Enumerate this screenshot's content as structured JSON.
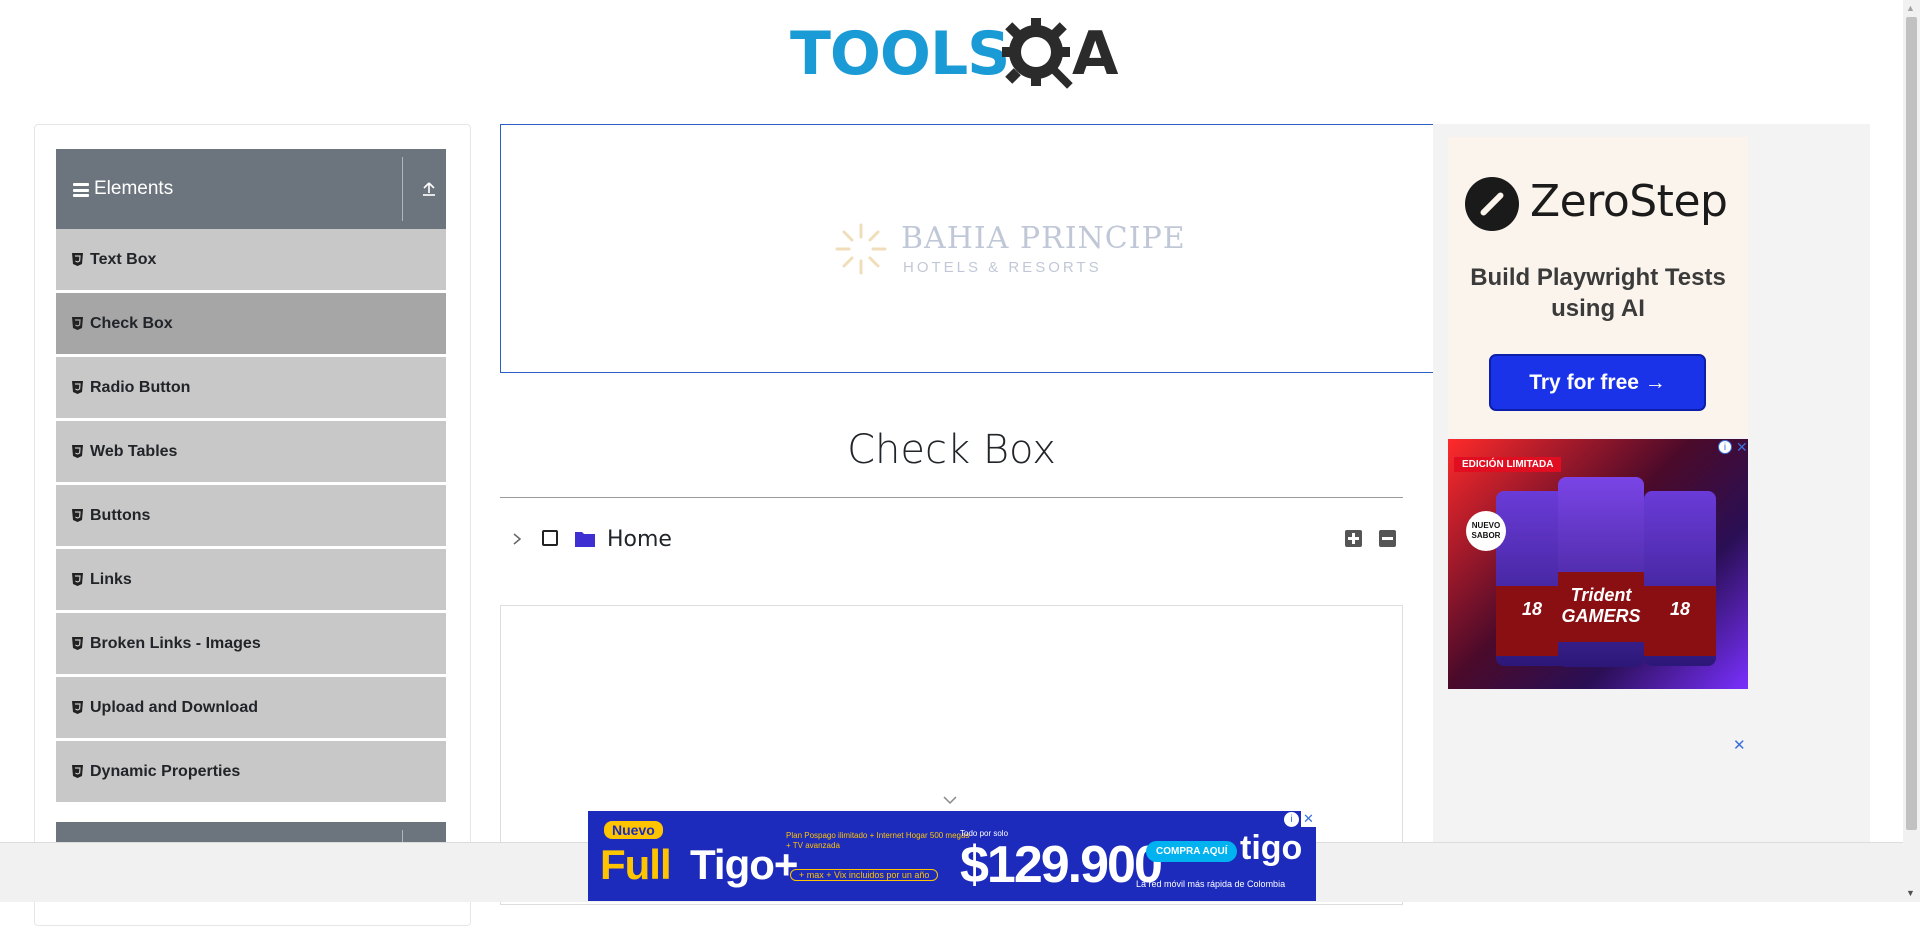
{
  "header": {
    "logo_text_left": "TOOLS",
    "logo_text_right": "A",
    "logo_alt": "TOOLSQA"
  },
  "sidebar": {
    "group_title": "Elements",
    "items": [
      {
        "label": "Text Box",
        "active": false
      },
      {
        "label": "Check Box",
        "active": true
      },
      {
        "label": "Radio Button",
        "active": false
      },
      {
        "label": "Web Tables",
        "active": false
      },
      {
        "label": "Buttons",
        "active": false
      },
      {
        "label": "Links",
        "active": false
      },
      {
        "label": "Broken Links - Images",
        "active": false
      },
      {
        "label": "Upload and Download",
        "active": false
      },
      {
        "label": "Dynamic Properties",
        "active": false
      }
    ]
  },
  "top_ad": {
    "brand": "BAHIA PRINCIPE",
    "tagline": "HOTELS & RESORTS"
  },
  "main": {
    "title": "Check Box",
    "tree": {
      "root_label": "Home",
      "checked": false,
      "expanded": false
    }
  },
  "right_ads": {
    "zerostep": {
      "name": "ZeroStep",
      "tagline": "Build Playwright Tests using AI",
      "cta": "Try for free →"
    },
    "trident": {
      "ribbon": "EDICIÓN LIMITADA",
      "badge": "NUEVO SABOR",
      "product": "Trident GAMERS",
      "count": "18"
    },
    "close_symbol": "✕",
    "adchoice_symbol": "i"
  },
  "bottom_ad": {
    "badge": "Nuevo",
    "headline_yellow": "Full",
    "headline_white": "Tigo+",
    "features": "Plan Pospago ilimitado + Internet Hogar 500 megas + TV avanzada",
    "features_extra": "+ max + Vix incluidos por un año",
    "from": "Todo por solo",
    "price": "$129.900",
    "cta": "COMPRA AQUÍ",
    "brand": "tigo",
    "slogan": "La red móvil más rápida de Colombia",
    "close_symbol": "✕",
    "adchoice_symbol": "i"
  },
  "colors": {
    "logo_blue": "#1a9bd6",
    "logo_dark": "#2b2b2b",
    "sidebar_header": "#6c757d",
    "sidebar_item": "#c8c8c8",
    "sidebar_active": "#a6a6a6",
    "zerostep_cta": "#1a33e8",
    "tigo_blue": "#1c2bbb",
    "tigo_yellow": "#ffc400"
  },
  "icons": {
    "menu": "hamburger-icon",
    "collapse_group": "upload-arrow-icon",
    "item": "html5-icon",
    "tree_toggle": "chevron-right-icon",
    "folder": "folder-icon",
    "expand_all": "plus-square-icon",
    "collapse_all": "minus-square-icon"
  }
}
